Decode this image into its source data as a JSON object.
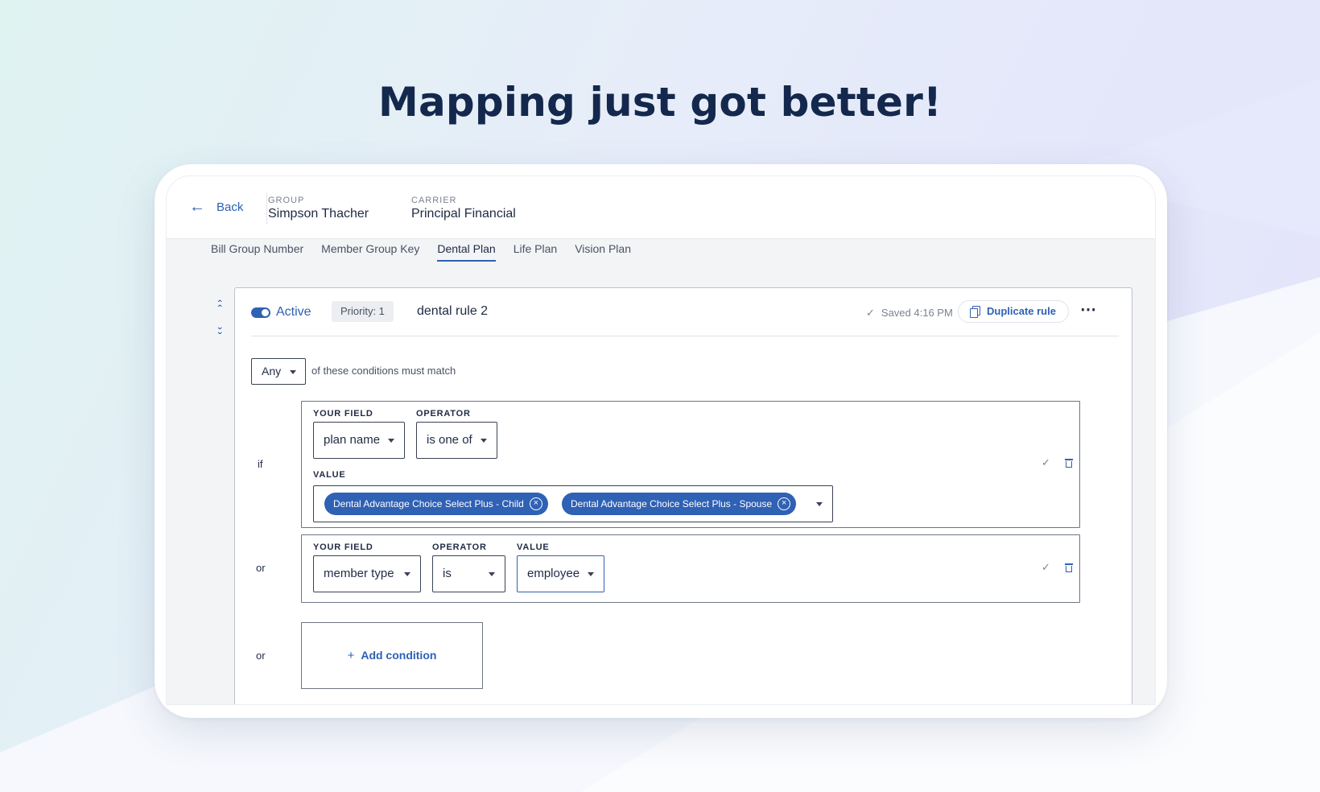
{
  "headline": "Mapping just got better!",
  "topbar": {
    "back_label": "Back",
    "group_label": "GROUP",
    "group_value": "Simpson Thacher",
    "carrier_label": "CARRIER",
    "carrier_value": "Principal Financial"
  },
  "tabs": [
    {
      "label": "Bill Group Number",
      "active": false
    },
    {
      "label": "Member Group Key",
      "active": false
    },
    {
      "label": "Dental Plan",
      "active": true
    },
    {
      "label": "Life Plan",
      "active": false
    },
    {
      "label": "Vision Plan",
      "active": false
    }
  ],
  "rule": {
    "status_label": "Active",
    "priority_label": "Priority: 1",
    "name": "dental rule 2",
    "saved_label": "Saved 4:16 PM",
    "duplicate_label": "Duplicate rule",
    "more_label": "⋯",
    "match_mode": "Any",
    "match_text": "of these conditions must match"
  },
  "conditions": [
    {
      "connector": "if",
      "field_label": "YOUR FIELD",
      "field_value": "plan name",
      "operator_label": "OPERATOR",
      "operator_value": "is one of",
      "value_label": "VALUE",
      "values": [
        "Dental Advantage Choice Select Plus - Child",
        "Dental Advantage Choice Select Plus - Spouse"
      ]
    },
    {
      "connector": "or",
      "field_label": "YOUR FIELD",
      "field_value": "member type",
      "operator_label": "OPERATOR",
      "operator_value": "is",
      "value_label": "VALUE",
      "value": "employee"
    }
  ],
  "add_condition": {
    "connector": "or",
    "label": "Add condition"
  },
  "icons": {
    "back": "arrow-left-icon",
    "nav_up": "double-chevron-up-icon",
    "nav_down": "double-chevron-down-icon",
    "saved": "check-icon",
    "duplicate": "copy-icon",
    "more": "more-horizontal-icon",
    "confirm": "check-icon",
    "delete": "trash-icon",
    "chip_remove": "close-circle-icon",
    "dropdown": "caret-down-icon",
    "add": "plus-icon"
  },
  "colors": {
    "accent": "#2f61b4",
    "headline": "#13284c"
  }
}
